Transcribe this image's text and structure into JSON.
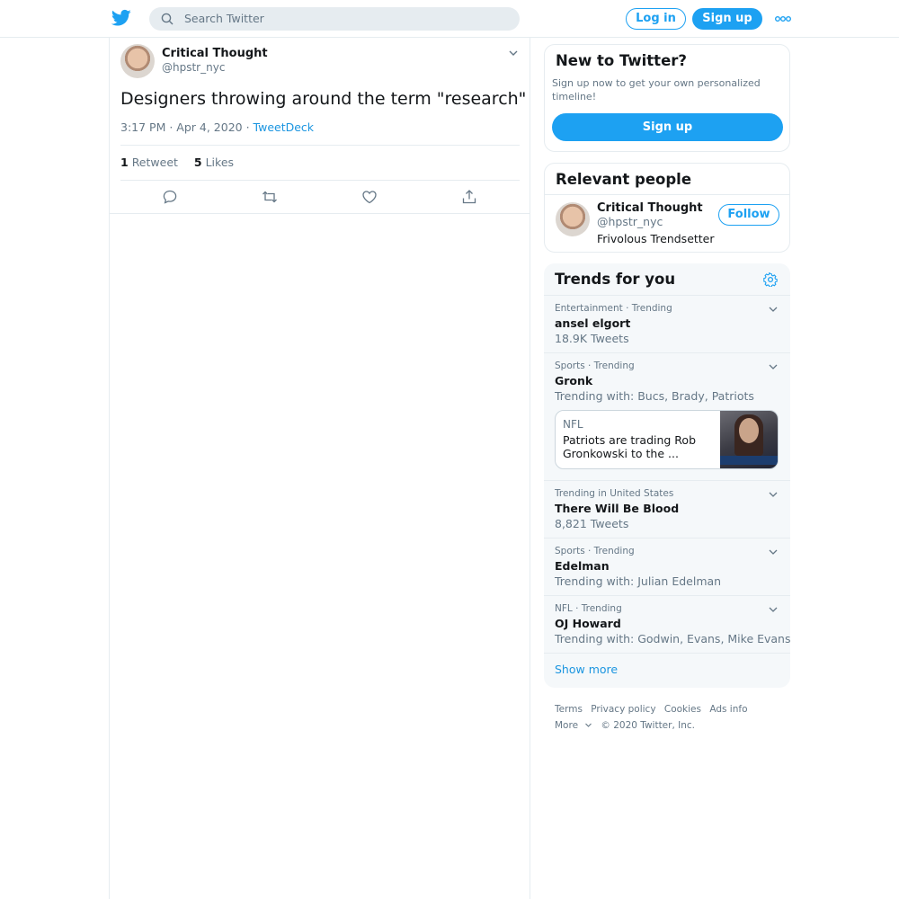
{
  "header": {
    "logo_icon": "twitter-bird-icon",
    "search_placeholder": "Search Twitter",
    "login_label": "Log in",
    "signup_label": "Sign up",
    "more_icon": "more-dots-icon"
  },
  "tweet": {
    "author_name": "Critical Thought",
    "author_handle": "@hpstr_nyc",
    "text": "Designers throwing around the term \"research\"",
    "time": "3:17 PM · Apr 4, 2020 · ",
    "source": "TweetDeck",
    "retweet_count": "1",
    "retweet_label": "Retweet",
    "like_count": "5",
    "like_label": "Likes",
    "actions": [
      "reply-icon",
      "retweet-icon",
      "like-icon",
      "share-icon"
    ]
  },
  "sidebar": {
    "new_to_twitter": {
      "title": "New to Twitter?",
      "text": "Sign up now to get your own personalized timeline!",
      "button": "Sign up"
    },
    "relevant": {
      "title": "Relevant people",
      "name": "Critical Thought",
      "handle": "@hpstr_nyc",
      "bio": "Frivolous Trendsetter",
      "follow": "Follow"
    },
    "trends": {
      "title": "Trends for you",
      "items": [
        {
          "meta": "Entertainment · Trending",
          "name": "ansel elgort",
          "sub": "18.9K Tweets"
        },
        {
          "meta": "Sports · Trending",
          "name": "Gronk",
          "sub": "Trending with: Bucs, Brady, Patriots",
          "news": {
            "source": "NFL",
            "title": "Patriots are trading Rob Gronkowski to the ..."
          }
        },
        {
          "meta": "Trending in United States",
          "name": "There Will Be Blood",
          "sub": "8,821 Tweets"
        },
        {
          "meta": "Sports · Trending",
          "name": "Edelman",
          "sub": "Trending with: Julian Edelman"
        },
        {
          "meta": "NFL · Trending",
          "name": "OJ Howard",
          "sub": "Trending with: Godwin, Evans, Mike Evans"
        }
      ],
      "show_more": "Show more"
    }
  },
  "footer": {
    "links": [
      "Terms",
      "Privacy policy",
      "Cookies",
      "Ads info"
    ],
    "more": "More",
    "copyright": "© 2020 Twitter, Inc."
  },
  "colors": {
    "accent": "#1da1f2",
    "link": "#1b95e0",
    "muted": "#657786",
    "border": "#e6ecf0",
    "panel": "#f5f8fa"
  }
}
